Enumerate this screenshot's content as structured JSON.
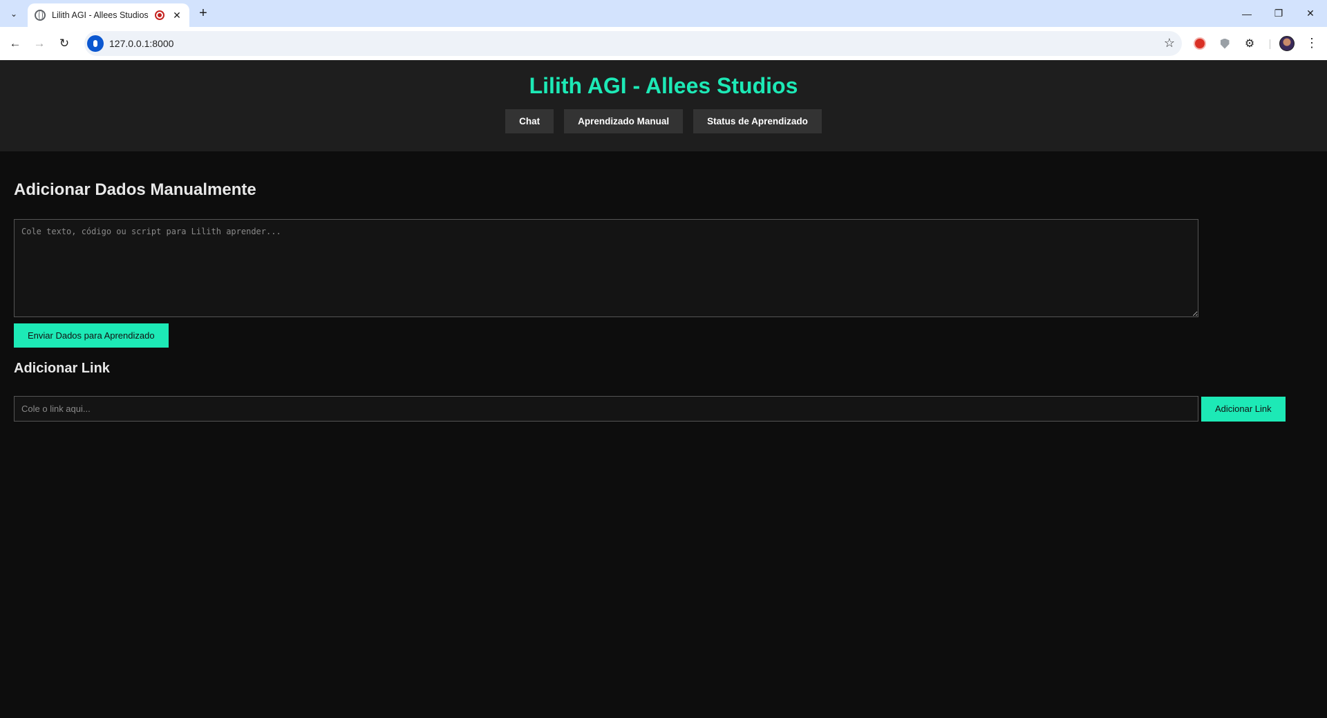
{
  "browser": {
    "tab_title": "Lilith AGI - Allees Studios",
    "address": "127.0.0.1:8000"
  },
  "header": {
    "title": "Lilith AGI - Allees Studios",
    "nav": [
      "Chat",
      "Aprendizado Manual",
      "Status de Aprendizado"
    ]
  },
  "manual": {
    "heading": "Adicionar Dados Manualmente",
    "textarea_placeholder": "Cole texto, código ou script para Lilith aprender...",
    "submit_label": "Enviar Dados para Aprendizado"
  },
  "link": {
    "heading": "Adicionar Link",
    "input_placeholder": "Cole o link aqui...",
    "button_label": "Adicionar Link"
  },
  "colors": {
    "accent": "#1de9b6",
    "header_bg": "#1e1e1e",
    "page_bg": "#0d0d0d",
    "nav_button_bg": "#333333"
  },
  "icons": [
    "tab-search-icon",
    "globe-icon",
    "recording-icon",
    "close-icon",
    "plus-icon",
    "back-icon",
    "forward-icon",
    "reload-icon",
    "mic-icon",
    "star-icon",
    "puzzle-icon",
    "shield-icon",
    "menu-icon"
  ]
}
